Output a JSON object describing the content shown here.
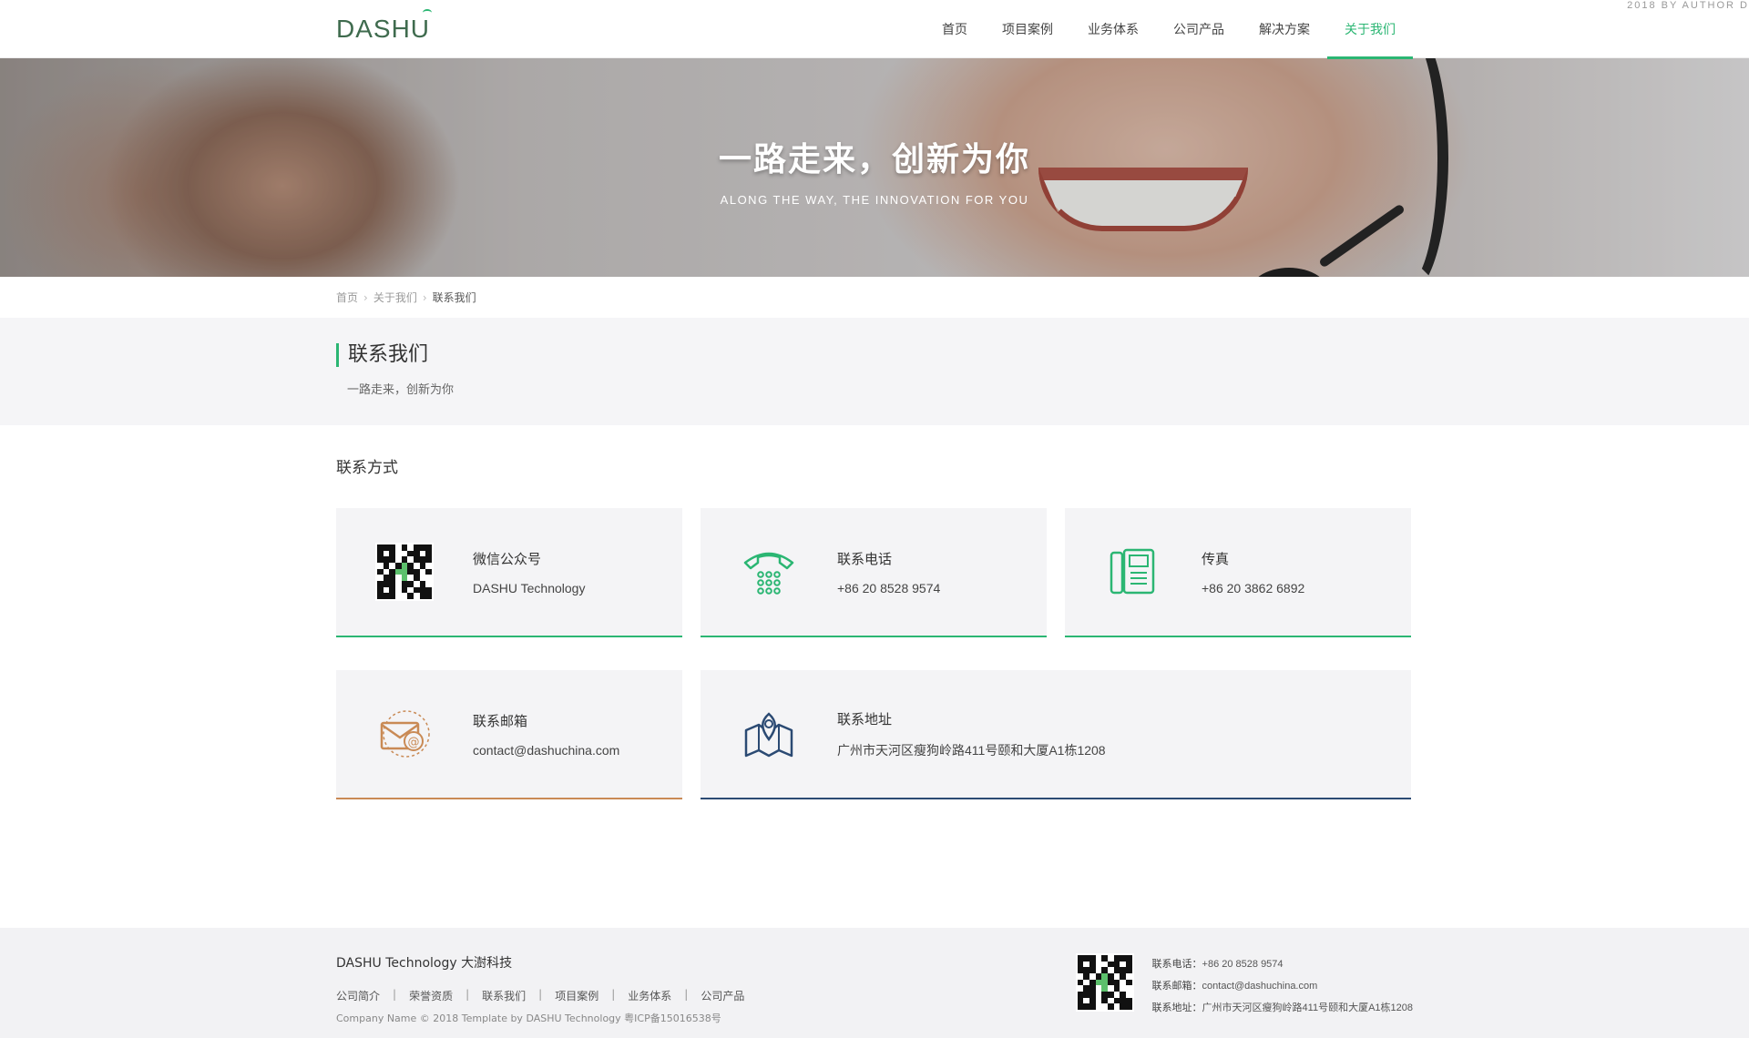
{
  "header": {
    "logo": "DASHU",
    "author_tag": "2018 BY AUTHOR D",
    "nav": [
      {
        "label": "首页"
      },
      {
        "label": "项目案例"
      },
      {
        "label": "业务体系"
      },
      {
        "label": "公司产品"
      },
      {
        "label": "解决方案"
      },
      {
        "label": "关于我们",
        "active": true
      }
    ]
  },
  "banner": {
    "title": "一路走来，创新为你",
    "subtitle": "ALONG THE WAY, THE INNOVATION FOR YOU"
  },
  "breadcrumb": {
    "home": "首页",
    "parent": "关于我们",
    "current": "联系我们"
  },
  "section": {
    "title": "联系我们",
    "desc": "一路走来，创新为你"
  },
  "contact": {
    "heading": "联系方式",
    "cards": [
      {
        "label": "微信公众号",
        "value": "DASHU Technology",
        "icon": "qr-code-icon"
      },
      {
        "label": "联系电话",
        "value": "+86 20 8528 9574",
        "icon": "telephone-icon"
      },
      {
        "label": "传真",
        "value": "+86 20 3862 6892",
        "icon": "fax-icon"
      },
      {
        "label": "联系邮箱",
        "value": "contact@dashuchina.com",
        "icon": "email-icon"
      },
      {
        "label": "联系地址",
        "value": "广州市天河区瘦狗岭路411号颐和大厦A1栋1208",
        "icon": "map-icon"
      }
    ],
    "colors": {
      "green": "#2bb673",
      "orange": "#c98a55",
      "navy": "#2b4a73"
    }
  },
  "footer": {
    "brand": "DASHU Technology 大澍科技",
    "links": [
      "公司简介",
      "荣誉资质",
      "联系我们",
      "项目案例",
      "业务体系",
      "公司产品"
    ],
    "copyright": "Company Name © 2018 Template by  DASHU Technology 粤ICP备15016538号",
    "phone_label": "联系电话：",
    "phone": "+86 20 8528 9574",
    "email_label": "联系邮箱：",
    "email": "contact@dashuchina.com",
    "address_label": "联系地址：",
    "address": "广州市天河区瘦狗岭路411号颐和大厦A1栋1208"
  }
}
